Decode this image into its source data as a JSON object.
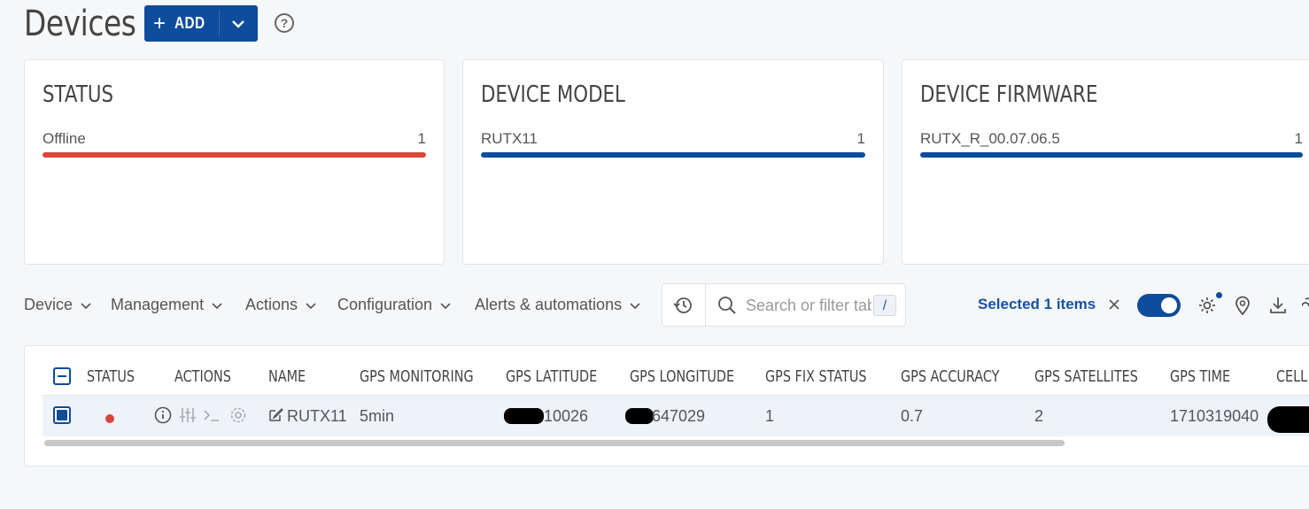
{
  "header": {
    "title": "Devices",
    "add_label": "ADD"
  },
  "cards": [
    {
      "title": "STATUS",
      "label": "Offline",
      "count": "1",
      "color": "#d9463b"
    },
    {
      "title": "DEVICE MODEL",
      "label": "RUTX11",
      "count": "1",
      "color": "#0e4c9c"
    },
    {
      "title": "DEVICE FIRMWARE",
      "label": "RUTX_R_00.07.06.5",
      "count": "1",
      "color": "#0e4c9c"
    }
  ],
  "toolbar": {
    "menus": [
      "Device",
      "Management",
      "Actions",
      "Configuration",
      "Alerts & automations"
    ],
    "search_placeholder": "Search or filter table",
    "shortcut": "/",
    "selected_text": "Selected 1 items",
    "toggle_on": true
  },
  "table": {
    "columns": [
      "STATUS",
      "ACTIONS",
      "NAME",
      "GPS MONITORING",
      "GPS LATITUDE",
      "GPS LONGITUDE",
      "GPS FIX STATUS",
      "GPS ACCURACY",
      "GPS SATELLITES",
      "GPS TIME",
      "CELL"
    ],
    "row": {
      "name": "RUTX11",
      "gps_monitoring": "5min",
      "gps_latitude": "10026",
      "gps_longitude": "647029",
      "gps_fix_status": "1",
      "gps_accuracy": "0.7",
      "gps_satellites": "2",
      "gps_time": "1710319040",
      "selected": true
    }
  },
  "colors": {
    "primary": "#0e4c9c",
    "offline": "#d9463b"
  }
}
